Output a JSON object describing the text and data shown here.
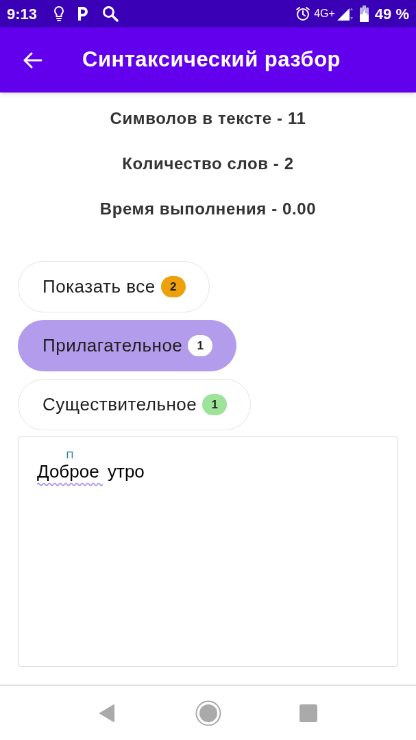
{
  "status_bar": {
    "time": "9:13",
    "network": "4G+",
    "battery": "49 %"
  },
  "app_bar": {
    "title": "Синтаксический разбор"
  },
  "stats": [
    "Символов в тексте - 11",
    "Количество слов - 2",
    "Время выполнения - 0.00"
  ],
  "filters": [
    {
      "label": "Показать все",
      "count": "2",
      "color": "#eba00c",
      "selected": false
    },
    {
      "label": "Прилагательное",
      "count": "1",
      "color": "#ffffff",
      "selected": true
    },
    {
      "label": "Существительное",
      "count": "1",
      "color": "#9de39a",
      "selected": false
    }
  ],
  "editor": {
    "words": [
      {
        "text": "Доброе",
        "tag": "П",
        "underlined": true
      },
      {
        "text": "утро",
        "underlined": false
      }
    ]
  }
}
